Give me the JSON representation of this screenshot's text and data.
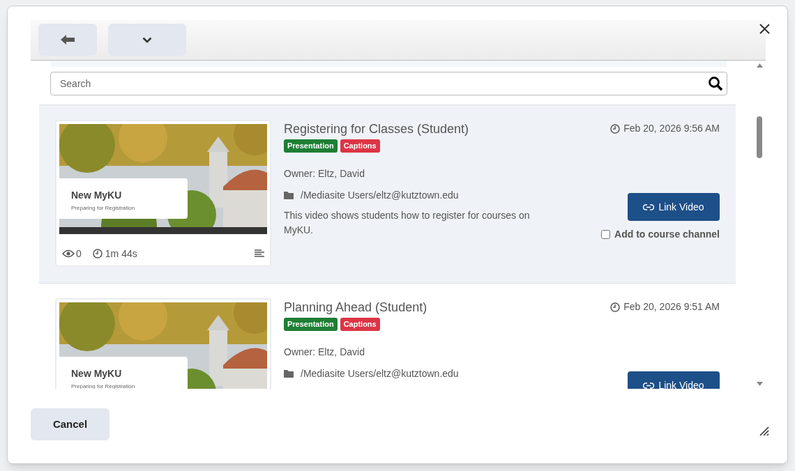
{
  "search": {
    "placeholder": "Search"
  },
  "videos": [
    {
      "title": "Registering for Classes (Student)",
      "date": "Feb 20, 2026 9:56 AM",
      "tags": [
        {
          "label": "Presentation",
          "color": "#1e7e34"
        },
        {
          "label": "Captions",
          "color": "#dc3545"
        }
      ],
      "owner": "Owner: Eltz, David",
      "folder": "/Mediasite Users/eltz@kutztown.edu",
      "description": "This video shows students how to register for courses on MyKU.",
      "thumbnail_title": "New MyKU",
      "thumbnail_subtitle": "Preparing for Registration",
      "views": "0",
      "duration": "1m 44s",
      "link_label": "Link Video",
      "channel_label": "Add to course channel",
      "channel_checked": false,
      "selected": true
    },
    {
      "title": "Planning Ahead (Student)",
      "date": "Feb 20, 2026 9:51 AM",
      "tags": [
        {
          "label": "Presentation",
          "color": "#1e7e34"
        },
        {
          "label": "Captions",
          "color": "#dc3545"
        }
      ],
      "owner": "Owner: Eltz, David",
      "folder": "/Mediasite Users/eltz@kutztown.edu",
      "thumbnail_title": "New MyKU",
      "thumbnail_subtitle": "Preparing for Registration",
      "link_label": "Link Video",
      "selected": false
    }
  ],
  "footer": {
    "cancel": "Cancel"
  }
}
